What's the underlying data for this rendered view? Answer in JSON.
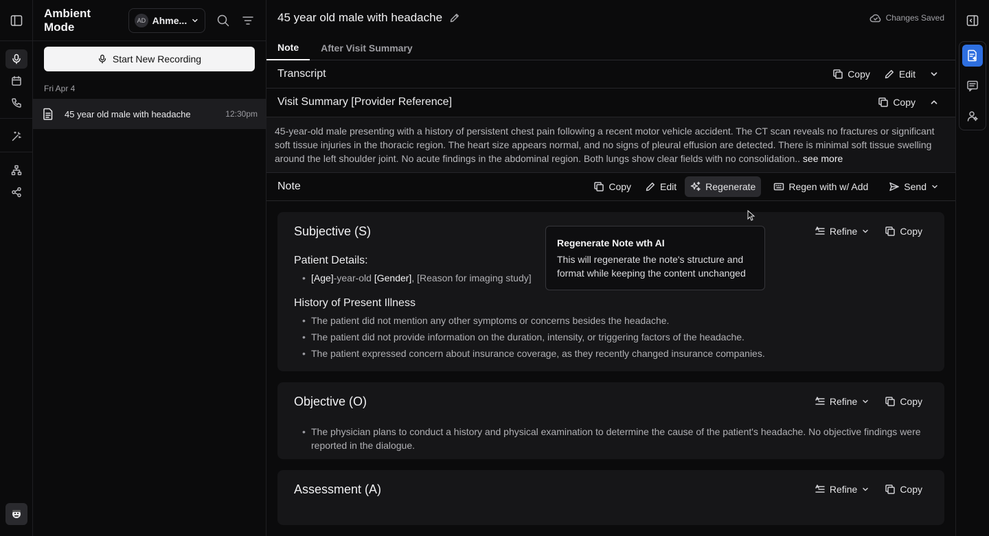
{
  "app": {
    "mode_title": "Ambient Mode",
    "user_initials": "AD",
    "user_name": "Ahme...",
    "record_label": "Start New Recording"
  },
  "sessions": {
    "date": "Fri Apr 4",
    "items": [
      {
        "name": "45 year old male with headache",
        "time": "12:30pm"
      }
    ]
  },
  "header": {
    "title": "45 year old male with headache",
    "status": "Changes Saved"
  },
  "tabs": [
    {
      "label": "Note"
    },
    {
      "label": "After Visit Summary"
    }
  ],
  "transcript": {
    "label": "Transcript",
    "copy": "Copy",
    "edit": "Edit"
  },
  "visit_summary": {
    "label": "Visit Summary [Provider Reference]",
    "copy": "Copy",
    "text": "45-year-old male presenting with a history of persistent chest pain following a recent motor vehicle accident. The CT scan reveals no fractures or significant soft tissue injuries in the thoracic region. The heart size appears normal, and no signs of pleural effusion are detected. There is minimal soft tissue swelling around the left shoulder joint. No acute findings in the abdominal region. Both lungs show clear fields with no consolidation..",
    "see_more": " see more"
  },
  "note": {
    "label": "Note",
    "copy": "Copy",
    "edit": "Edit",
    "regenerate": "Regenerate",
    "regen_add": "Regen with w/ Add",
    "send": "Send"
  },
  "tooltip": {
    "title": "Regenerate Note wth AI",
    "text": "This will regenerate the note's structure and format while keeping the content unchanged"
  },
  "sections": {
    "subjective": {
      "title": "Subjective (S)",
      "refine": "Refine",
      "copy": "Copy",
      "patient_details_heading": "Patient Details:",
      "pd_age": "[Age]",
      "pd_mid": "-year-old ",
      "pd_gender": "[Gender]",
      "pd_rest": ", [Reason for imaging study]",
      "hpi_heading": "History of Present Illness",
      "hpi": [
        "The patient did not mention any other symptoms or concerns besides the headache.",
        "The patient did not provide information on the duration, intensity, or triggering factors of the headache.",
        "The patient expressed concern about insurance coverage, as they recently changed insurance companies."
      ]
    },
    "objective": {
      "title": "Objective (O)",
      "refine": "Refine",
      "copy": "Copy",
      "items": [
        "The physician plans to conduct a history and physical examination to determine the cause of the patient's headache. No objective findings were reported in the dialogue."
      ]
    },
    "assessment": {
      "title": "Assessment (A)",
      "refine": "Refine",
      "copy": "Copy"
    }
  },
  "icons": {
    "left_rail": [
      "sidebar-toggle-icon",
      "microphone-icon",
      "calendar-icon",
      "phone-icon",
      "magic-wand-icon",
      "hierarchy-icon",
      "share-icon",
      "assistant-avatar-icon"
    ],
    "right_rail": [
      "panel-collapse-icon",
      "document-ai-icon",
      "chat-icon",
      "person-star-icon"
    ]
  },
  "colors": {
    "accent": "#2e6fe0",
    "background": "#0b0b0c",
    "card": "#161618"
  }
}
